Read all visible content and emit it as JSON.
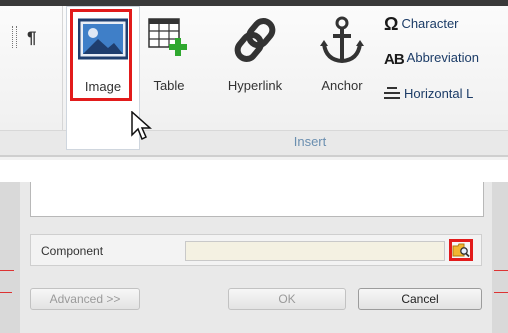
{
  "ribbon": {
    "pilcrow": "¶",
    "buttons": {
      "image": {
        "label": "Image",
        "icon": "image-icon"
      },
      "table": {
        "label": "Table",
        "icon": "table-icon"
      },
      "hyperlink": {
        "label": "Hyperlink",
        "icon": "hyperlink-icon"
      },
      "anchor": {
        "label": "Anchor",
        "icon": "anchor-icon"
      }
    },
    "small_items": [
      {
        "icon_glyph": "Ω",
        "label": "Character",
        "icon": "omega-icon"
      },
      {
        "icon_glyph": "AB",
        "label": "Abbreviation",
        "icon": "abbreviation-icon"
      },
      {
        "icon_glyph": "",
        "label": "Horizontal L",
        "icon": "horizontal-line-icon"
      }
    ],
    "group_label": "Insert"
  },
  "dialog": {
    "component_label": "Component",
    "component_value": "",
    "browse_icon": "folder-search-icon",
    "advanced_label": "Advanced >>",
    "ok_label": "OK",
    "cancel_label": "Cancel"
  },
  "colors": {
    "highlight": "#e21b1b",
    "group_label": "#6b8fb0",
    "table_plus": "#2fa82f"
  }
}
